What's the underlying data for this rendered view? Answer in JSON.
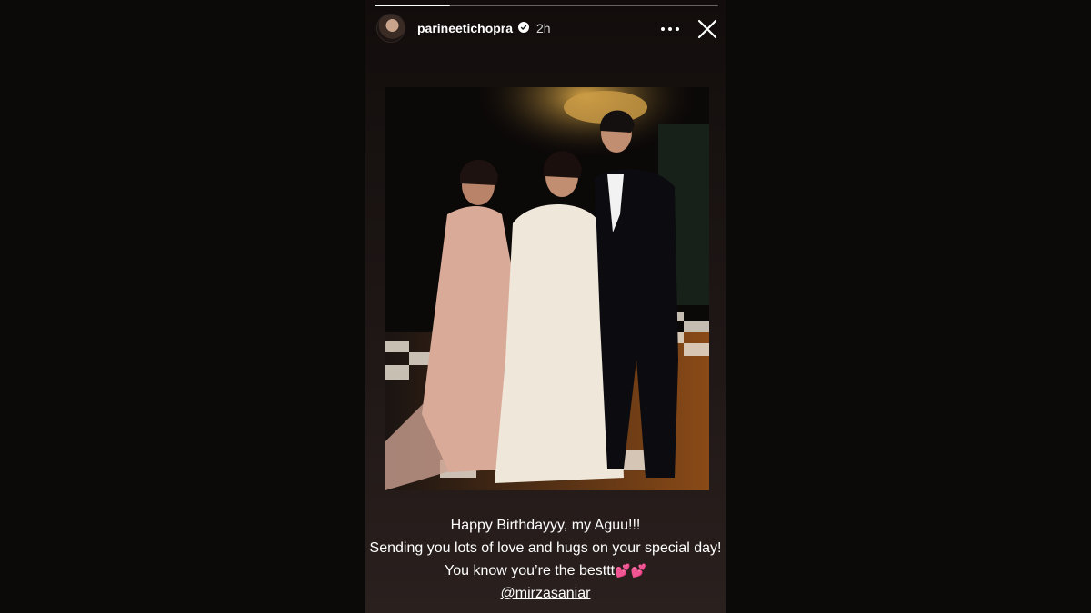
{
  "story": {
    "progress": 0.22,
    "username": "parineetichopra",
    "verified": true,
    "time_ago": "2h",
    "icons": {
      "avatar": "profile-avatar",
      "verified": "verified-badge-icon",
      "more": "more-options-icon",
      "close": "close-icon"
    }
  },
  "caption": {
    "line1": "Happy Birthdayyy, my Aguu!!!",
    "line2": "Sending you lots of love and hugs on your special day!",
    "line3": "You know you’re the besttt",
    "emoji": "💕💕",
    "mention": "@mirzasaniar"
  },
  "colors": {
    "background": "#0c0909",
    "text": "#ffffff",
    "accent_heart": "#ff4fa7"
  }
}
